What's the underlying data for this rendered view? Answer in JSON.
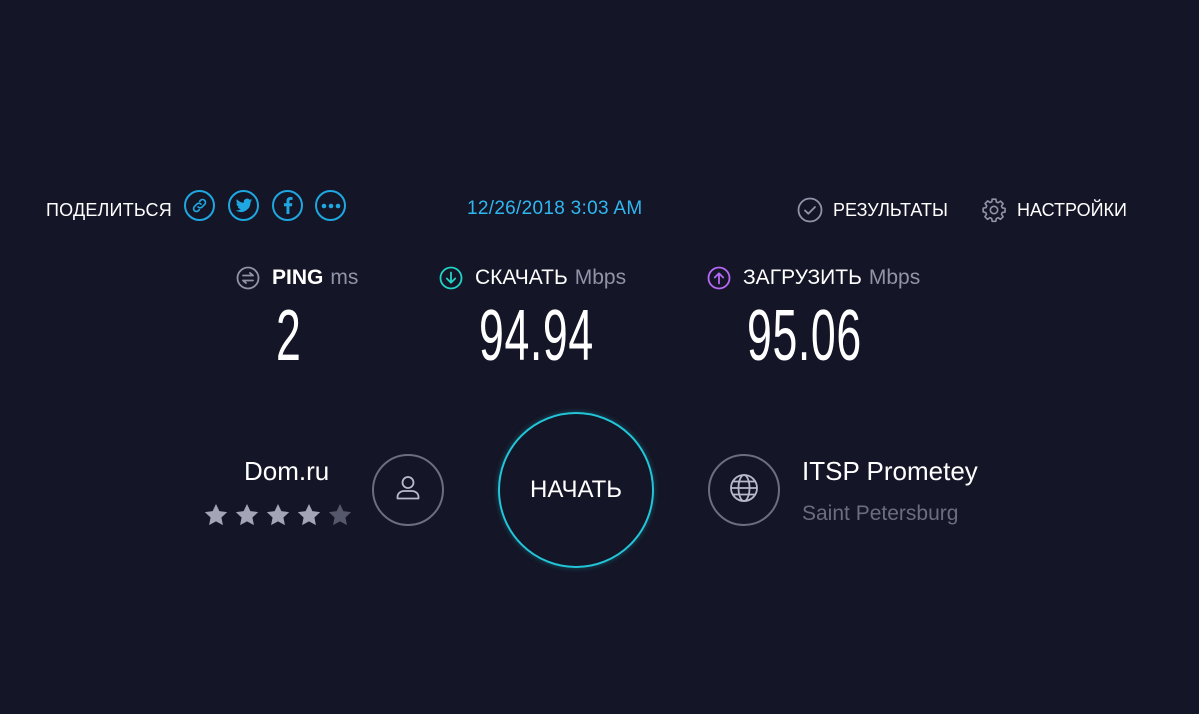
{
  "share": {
    "label": "ПОДЕЛИТЬСЯ",
    "buttons": [
      {
        "icon": "link-icon"
      },
      {
        "icon": "twitter-icon"
      },
      {
        "icon": "facebook-icon"
      },
      {
        "icon": "more-icon"
      }
    ]
  },
  "datetime": "12/26/2018 3:03 AM",
  "nav": {
    "results_label": "РЕЗУЛЬТАТЫ",
    "settings_label": "НАСТРОЙКИ"
  },
  "metrics": {
    "ping": {
      "name": "PING",
      "unit": "ms",
      "value": "2",
      "icon_color": "#9193a8"
    },
    "download": {
      "name": "СКАЧАТЬ",
      "unit": "Mbps",
      "value": "94.94",
      "icon_color": "#22d3c5"
    },
    "upload": {
      "name": "ЗАГРУЗИТЬ",
      "unit": "Mbps",
      "value": "95.06",
      "icon_color": "#b768f5"
    }
  },
  "provider": {
    "name": "Dom.ru",
    "rating": 4,
    "rating_max": 5
  },
  "start_label": "НАЧАТЬ",
  "server": {
    "name": "ITSP Prometey",
    "location": "Saint Petersburg"
  },
  "colors": {
    "background": "#141526",
    "accent_blue": "#1ea7e0",
    "start_ring": "#21c6d8",
    "muted": "#6b6d80"
  }
}
